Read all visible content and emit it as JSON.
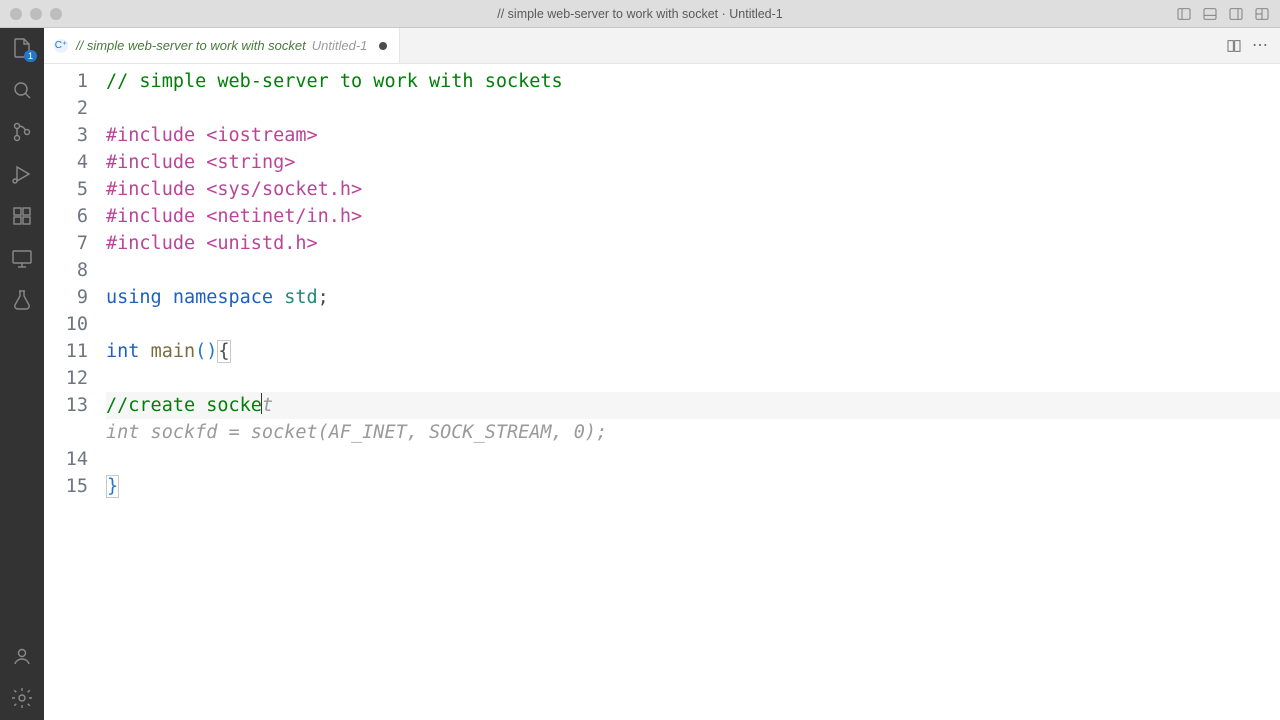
{
  "window": {
    "title": "// simple web-server to work with socket · Untitled-1"
  },
  "activity": {
    "explorer_badge": "1"
  },
  "tab": {
    "lang_letter": "C⁺",
    "name": "// simple web-server to work with socket",
    "sub": "Untitled-1"
  },
  "code": {
    "lines": [
      {
        "n": "1",
        "parts": [
          {
            "cls": "tok-comment",
            "t": "// simple web-server to work with sockets"
          }
        ]
      },
      {
        "n": "2",
        "parts": []
      },
      {
        "n": "3",
        "parts": [
          {
            "cls": "tok-directive",
            "t": "#include "
          },
          {
            "cls": "tok-macro",
            "t": "<iostream>"
          }
        ]
      },
      {
        "n": "4",
        "parts": [
          {
            "cls": "tok-directive",
            "t": "#include "
          },
          {
            "cls": "tok-macro",
            "t": "<string>"
          }
        ]
      },
      {
        "n": "5",
        "parts": [
          {
            "cls": "tok-directive",
            "t": "#include "
          },
          {
            "cls": "tok-macro",
            "t": "<sys/socket.h>"
          }
        ]
      },
      {
        "n": "6",
        "parts": [
          {
            "cls": "tok-directive",
            "t": "#include "
          },
          {
            "cls": "tok-macro",
            "t": "<netinet/in.h>"
          }
        ]
      },
      {
        "n": "7",
        "parts": [
          {
            "cls": "tok-directive",
            "t": "#include "
          },
          {
            "cls": "tok-macro",
            "t": "<unistd.h>"
          }
        ]
      },
      {
        "n": "8",
        "parts": []
      },
      {
        "n": "9",
        "parts": [
          {
            "cls": "tok-kw",
            "t": "using "
          },
          {
            "cls": "tok-kw",
            "t": "namespace "
          },
          {
            "cls": "tok-ns",
            "t": "std"
          },
          {
            "cls": "tok-punct",
            "t": ";"
          }
        ]
      },
      {
        "n": "10",
        "parts": []
      },
      {
        "n": "11",
        "parts": [
          {
            "cls": "tok-type",
            "t": "int "
          },
          {
            "cls": "tok-func",
            "t": "main"
          },
          {
            "cls": "tok-bracket",
            "t": "()"
          },
          {
            "cls": "tok-punct hl-bracket",
            "t": "{"
          }
        ]
      },
      {
        "n": "12",
        "parts": []
      },
      {
        "n": "13",
        "current": true,
        "parts": [
          {
            "cls": "tok-comment",
            "t": "//create socke"
          },
          {
            "cursor": true
          },
          {
            "cls": "ghost",
            "t": "t"
          }
        ]
      },
      {
        "n": "13b",
        "ghostline": true,
        "parts": [
          {
            "cls": "ghost",
            "t": "int sockfd = socket(AF_INET, SOCK_STREAM, 0);"
          }
        ]
      },
      {
        "n": "14",
        "parts": []
      },
      {
        "n": "15",
        "parts": [
          {
            "cls": "tok-bracket hl-bracket",
            "t": "}"
          }
        ]
      }
    ]
  }
}
